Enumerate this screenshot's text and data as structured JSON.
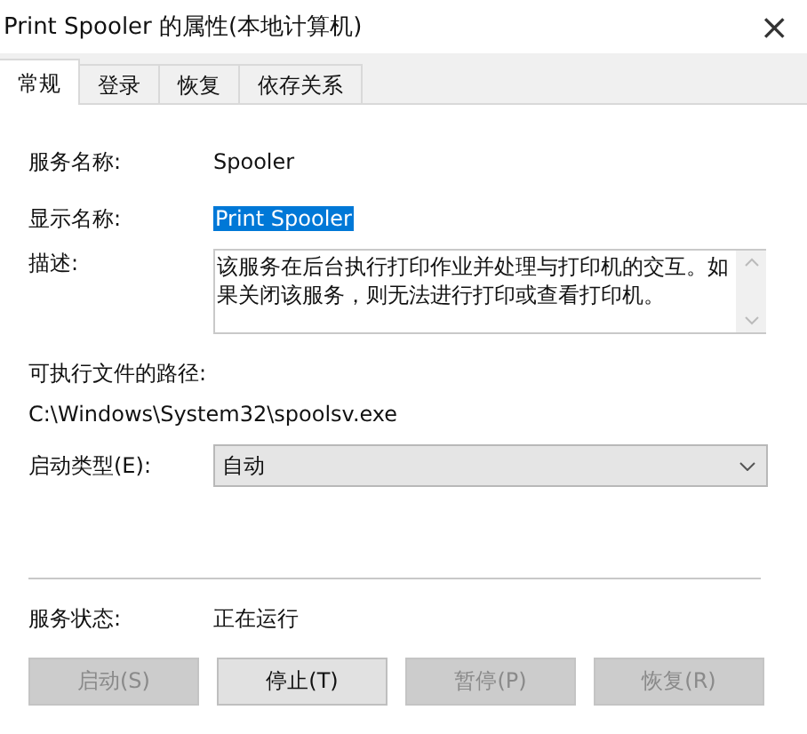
{
  "window": {
    "title": "Print Spooler 的属性(本地计算机)",
    "close": "×"
  },
  "tabs": [
    {
      "label": "常规",
      "selected": true
    },
    {
      "label": "登录",
      "selected": false
    },
    {
      "label": "恢复",
      "selected": false
    },
    {
      "label": "依存关系",
      "selected": false
    }
  ],
  "service_name": {
    "label": "服务名称:",
    "value": "Spooler"
  },
  "display_name": {
    "label": "显示名称:",
    "value": "Print Spooler",
    "selected": true
  },
  "description": {
    "label": "描述:",
    "value": "该服务在后台执行打印作业并处理与打印机的交互。如果关闭该服务，则无法进行打印或查看打印机。"
  },
  "executable_path": {
    "label": "可执行文件的路径:",
    "value": "C:\\Windows\\System32\\spoolsv.exe"
  },
  "startup_type": {
    "label": "启动类型(E):",
    "value": "自动"
  },
  "service_status": {
    "label": "服务状态:",
    "value": "正在运行"
  },
  "buttons": [
    {
      "label": "启动(S)",
      "disabled": true
    },
    {
      "label": "停止(T)",
      "disabled": false
    },
    {
      "label": "暂停(P)",
      "disabled": true
    },
    {
      "label": "恢复(R)",
      "disabled": true
    }
  ]
}
